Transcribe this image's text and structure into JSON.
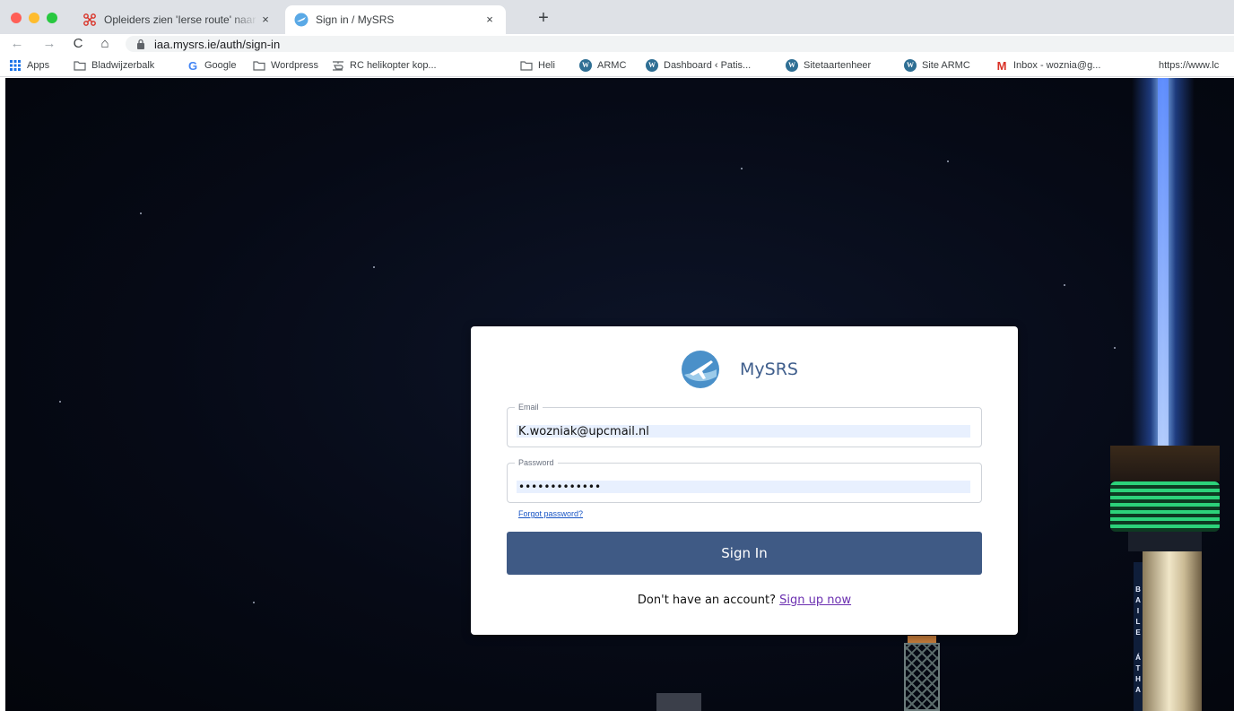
{
  "browser": {
    "tabs": [
      {
        "title": "Opleiders zien 'Ierse route' naar",
        "close": "×",
        "favicon": "drone-icon"
      },
      {
        "title": "Sign in / MySRS",
        "close": "×",
        "favicon": "mysrs-plane-icon",
        "active": true
      }
    ],
    "new_tab": "+",
    "nav": {
      "back": "←",
      "forward": "→",
      "reload": "C",
      "home": "⌂"
    },
    "url": "iaa.mysrs.ie/auth/sign-in",
    "bookmarks": [
      {
        "label": "Apps",
        "icon": "apps-grid-icon"
      },
      {
        "label": "Bladwijzerbalk",
        "icon": "folder-icon"
      },
      {
        "label": "Google",
        "icon": "google-icon"
      },
      {
        "label": "Wordpress",
        "icon": "folder-icon"
      },
      {
        "label": "RC helikopter kop...",
        "icon": "helicopter-icon"
      },
      {
        "label": "Heli",
        "icon": "folder-icon"
      },
      {
        "label": "ARMC",
        "icon": "wordpress-icon"
      },
      {
        "label": "Dashboard ‹ Patis...",
        "icon": "wordpress-icon"
      },
      {
        "label": "Sitetaartenheer",
        "icon": "wordpress-icon"
      },
      {
        "label": "Site ARMC",
        "icon": "wordpress-icon"
      },
      {
        "label": "Inbox - woznia@g...",
        "icon": "gmail-icon"
      },
      {
        "label": "https://www.lc",
        "icon": ""
      }
    ]
  },
  "signin": {
    "brand": "MySRS",
    "email_label": "Email",
    "email_value": "K.wozniak@upcmail.nl",
    "password_label": "Password",
    "password_value": "•••••••••••••",
    "forgot": "Forgot password?",
    "button": "Sign In",
    "signup_prompt": "Don't have an account?",
    "signup_link": "Sign up now"
  },
  "background": {
    "tower_letters": [
      "B",
      "A",
      "I",
      "L",
      "E",
      "",
      "Á",
      "T",
      "H",
      "A"
    ]
  },
  "colors": {
    "button": "#3f5a85",
    "brand": "#3f5e8c",
    "link": "#1a56c5",
    "signup_link": "#6b2fb0",
    "autofill": "#e8f0fe"
  }
}
